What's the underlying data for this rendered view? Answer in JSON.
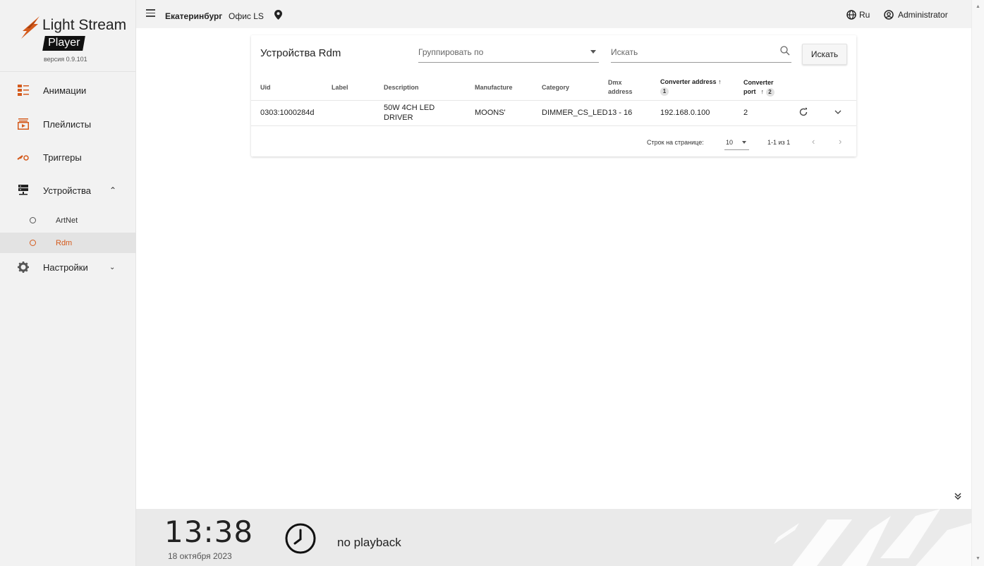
{
  "brand": {
    "name": "Light Stream",
    "product": "Player",
    "version": "версия 0.9.101",
    "accent": "#d45a1c"
  },
  "sidebar": {
    "items": [
      {
        "label": "Анимации",
        "icon": "animations-icon"
      },
      {
        "label": "Плейлисты",
        "icon": "playlist-icon"
      },
      {
        "label": "Триггеры",
        "icon": "triggers-icon"
      },
      {
        "label": "Устройства",
        "icon": "devices-icon",
        "expanded": true
      },
      {
        "label": "Настройки",
        "icon": "gear-icon",
        "expanded": false
      }
    ],
    "sub_items": [
      {
        "label": "ArtNet",
        "active": false
      },
      {
        "label": "Rdm",
        "active": true
      }
    ]
  },
  "topbar": {
    "city": "Екатеринбург",
    "office": "Офис LS",
    "language": "Ru",
    "user": "Administrator"
  },
  "card": {
    "title": "Устройства Rdm",
    "group_placeholder": "Группировать по",
    "search_placeholder": "Искать",
    "search_button": "Искать",
    "columns": {
      "uid": "Uid",
      "label": "Label",
      "description": "Description",
      "manufacture": "Manufacture",
      "category": "Category",
      "dmx": "Dmx address",
      "converter_address": "Converter address",
      "converter_address_sort": "1",
      "converter_port": "Converter port",
      "converter_port_sort": "2"
    },
    "rows": [
      {
        "uid": "0303:1000284d",
        "label": "",
        "description": "50W 4CH LED DRIVER",
        "manufacture": "MOONS'",
        "category": "DIMMER_CS_LED",
        "dmx": "13 - 16",
        "converter_address": "192.168.0.100",
        "converter_port": "2"
      }
    ],
    "pager": {
      "rows_per_page_label": "Строк на странице:",
      "rows_per_page": "10",
      "range": "1-1 из 1"
    }
  },
  "bottombar": {
    "time": "13:38",
    "date": "18 октября 2023",
    "playback_status": "no playback"
  }
}
